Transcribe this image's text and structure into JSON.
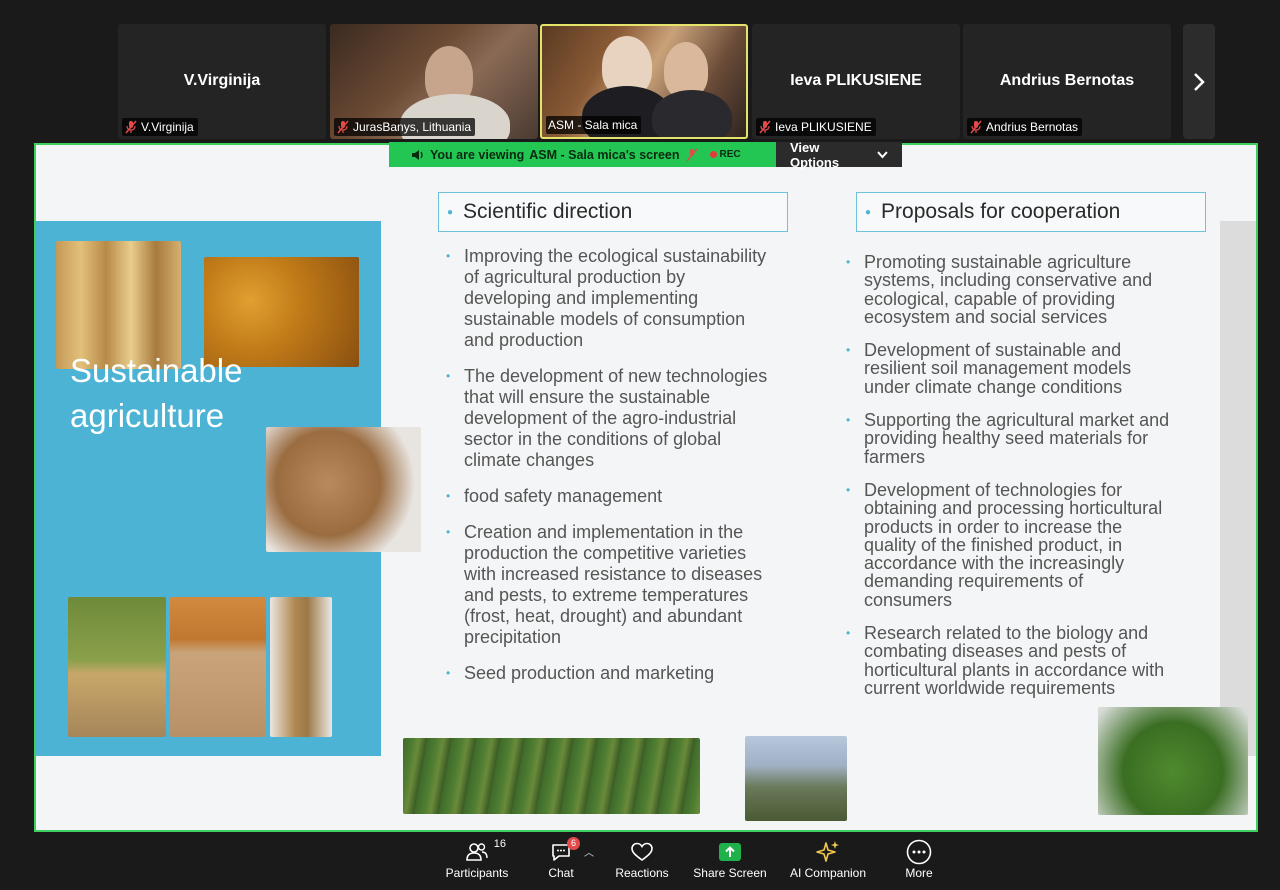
{
  "gallery": {
    "tiles": [
      {
        "name": "V.Virginija",
        "label": "V.Virginija"
      },
      {
        "label": "JurasBanys, Lithuania"
      },
      {
        "label": "ASM - Sala mica"
      },
      {
        "name": "Ieva PLIKUSIENE",
        "label": "Ieva PLIKUSIENE"
      },
      {
        "name": "Andrius Bernotas",
        "label": "Andrius Bernotas"
      }
    ],
    "next_icon": "chevron-right-icon"
  },
  "share_banner": {
    "viewing": "You are viewing",
    "presenter": "ASM - Sala mica's screen",
    "rec": "REC",
    "view_options": "View Options"
  },
  "slide": {
    "title_line1": "Sustainable",
    "title_line2": "agriculture",
    "col1_header": "Scientific direction",
    "col1_items": [
      "Improving the ecological sustainability of agricultural production by developing and implementing sustainable models of consumption and production",
      "The development of new technologies that will ensure the sustainable development of the agro-industrial sector in the conditions of global climate changes",
      "food safety management",
      "Creation and implementation in the production the competitive varieties with increased resistance to diseases and pests, to extreme temperatures (frost, heat, drought) and abundant precipitation",
      "Seed production and marketing"
    ],
    "col2_header": "Proposals for cooperation",
    "col2_items": [
      "Promoting sustainable agriculture systems, including conservative and ecological, capable of providing ecosystem and social services",
      "Development of sustainable and resilient soil management models under climate change conditions",
      "Supporting the agricultural market and providing healthy seed materials for farmers",
      "Development of technologies for obtaining and processing horticultural products in order to increase the quality of the finished product, in accordance with the increasingly demanding requirements of consumers",
      "Research related to the biology and combating diseases and pests of horticultural plants in accordance with current worldwide requirements"
    ]
  },
  "toolbar": {
    "participants_label": "Participants",
    "participants_count": "16",
    "chat_label": "Chat",
    "chat_badge": "6",
    "reactions_label": "Reactions",
    "share_label": "Share Screen",
    "ai_label": "AI Companion",
    "more_label": "More"
  },
  "colors": {
    "share_green": "#23c553",
    "slide_blue": "#4db3d4",
    "share_screen_green": "#1fb14a",
    "mute_red": "#e34b4b"
  }
}
